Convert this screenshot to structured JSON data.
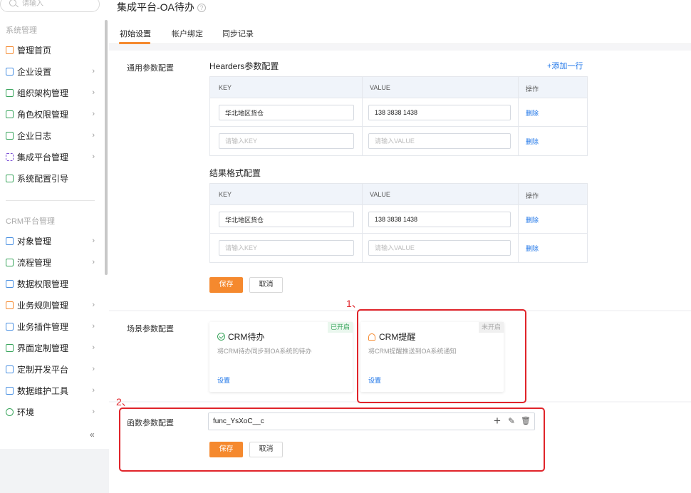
{
  "search": {
    "placeholder": "请输入"
  },
  "sidebar": {
    "section1": "系统管理",
    "section2": "CRM平台管理",
    "items1": [
      {
        "label": "管理首页",
        "chevron": ""
      },
      {
        "label": "企业设置",
        "chevron": "›"
      },
      {
        "label": "组织架构管理",
        "chevron": "›"
      },
      {
        "label": "角色权限管理",
        "chevron": "›"
      },
      {
        "label": "企业日志",
        "chevron": "›"
      },
      {
        "label": "集成平台管理",
        "chevron": "›"
      },
      {
        "label": "系统配置引导",
        "chevron": ""
      }
    ],
    "items2": [
      {
        "label": "对象管理",
        "chevron": "›"
      },
      {
        "label": "流程管理",
        "chevron": "›"
      },
      {
        "label": "数据权限管理",
        "chevron": ""
      },
      {
        "label": "业务规则管理",
        "chevron": "›"
      },
      {
        "label": "业务插件管理",
        "chevron": "›"
      },
      {
        "label": "界面定制管理",
        "chevron": "›"
      },
      {
        "label": "定制开发平台",
        "chevron": "›"
      },
      {
        "label": "数据维护工具",
        "chevron": "›"
      },
      {
        "label": "环境",
        "chevron": "›"
      }
    ],
    "collapse": "«"
  },
  "page": {
    "title": "集成平台-OA待办",
    "help": "?"
  },
  "tabs": [
    "初始设置",
    "帐户绑定",
    "同步记录"
  ],
  "general": {
    "label": "通用参数配置",
    "headers_title": "Hearders参数配置",
    "add_row": "+添加一行",
    "result_title": "结果格式配置",
    "col_key": "KEY",
    "col_value": "VALUE",
    "col_op": "操作",
    "rows": [
      {
        "key": "华北地区货仓",
        "value": "138 3838 1438",
        "del": "删除"
      },
      {
        "key": "",
        "value": "",
        "del": "删除"
      }
    ],
    "key_placeholder": "请输入KEY",
    "value_placeholder": "请输入VALUE",
    "save": "保存",
    "cancel": "取消"
  },
  "scene": {
    "label": "场景参数配置",
    "cards": [
      {
        "title": "CRM待办",
        "desc": "将CRM待办同步到OA系统的待办",
        "badge": "已开启",
        "link": "设置"
      },
      {
        "title": "CRM提醒",
        "desc": "将CRM提醒推送到OA系统通知",
        "badge": "未开启",
        "link": "设置"
      }
    ]
  },
  "func": {
    "label": "函数参数配置",
    "value": "func_YsXoC__c",
    "add_icon": "+",
    "edit_icon": "✎",
    "delete_icon": "🗑",
    "save": "保存",
    "cancel": "取消"
  },
  "annotations": {
    "a1": "1、",
    "a2": "2、"
  },
  "colors": {
    "accent": "#f5892e",
    "link": "#1a73e8",
    "highlight": "#e0242a",
    "success": "#3aa55d"
  }
}
